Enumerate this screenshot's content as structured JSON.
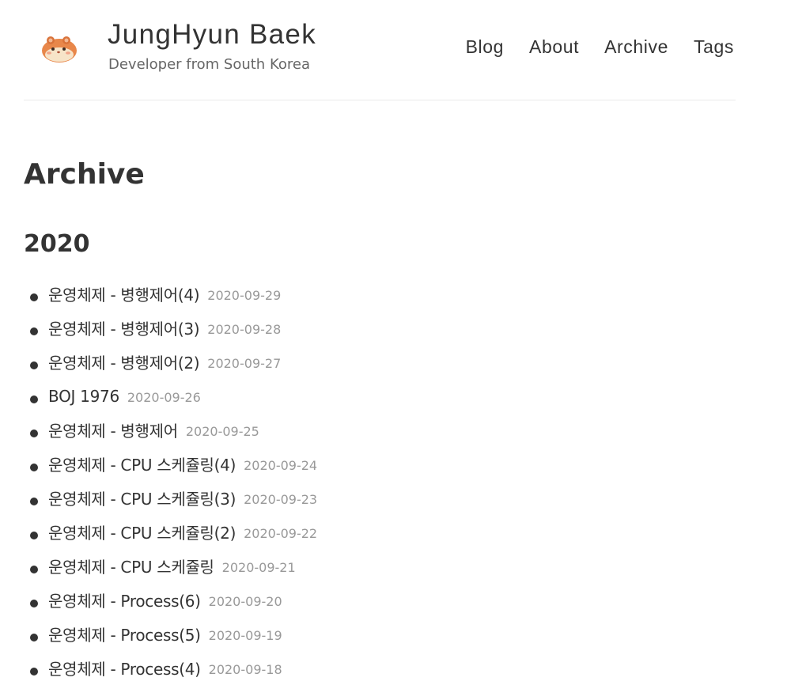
{
  "header": {
    "title": "JungHyun Baek",
    "description": "Developer from South Korea",
    "logo_icon": "hamster-logo-icon"
  },
  "nav": {
    "items": [
      {
        "label": "Blog"
      },
      {
        "label": "About"
      },
      {
        "label": "Archive"
      },
      {
        "label": "Tags"
      }
    ]
  },
  "main": {
    "title": "Archive",
    "years": [
      {
        "year": "2020",
        "posts": [
          {
            "title": "운영체제 - 병행제어(4)",
            "date": "2020-09-29"
          },
          {
            "title": "운영체제 - 병행제어(3)",
            "date": "2020-09-28"
          },
          {
            "title": "운영체제 - 병행제어(2)",
            "date": "2020-09-27"
          },
          {
            "title": "BOJ 1976",
            "date": "2020-09-26"
          },
          {
            "title": "운영체제 - 병행제어",
            "date": "2020-09-25"
          },
          {
            "title": "운영체제 - CPU 스케쥴링(4)",
            "date": "2020-09-24"
          },
          {
            "title": "운영체제 - CPU 스케쥴링(3)",
            "date": "2020-09-23"
          },
          {
            "title": "운영체제 - CPU 스케쥴링(2)",
            "date": "2020-09-22"
          },
          {
            "title": "운영체제 - CPU 스케쥴링",
            "date": "2020-09-21"
          },
          {
            "title": "운영체제 - Process(6)",
            "date": "2020-09-20"
          },
          {
            "title": "운영체제 - Process(5)",
            "date": "2020-09-19"
          },
          {
            "title": "운영체제 - Process(4)",
            "date": "2020-09-18"
          }
        ]
      }
    ]
  },
  "colors": {
    "text": "#333333",
    "muted": "#999999",
    "border": "#ebebeb",
    "logo_orange": "#e8874a",
    "logo_cream": "#f7e4c8"
  }
}
